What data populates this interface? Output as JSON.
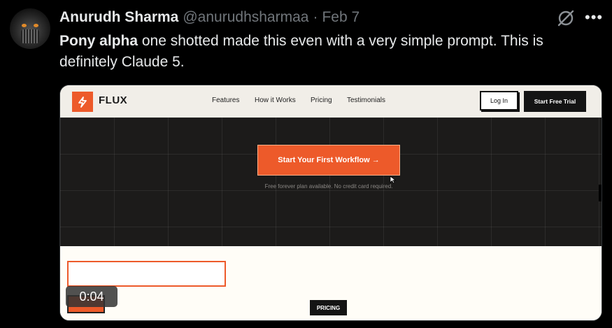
{
  "tweet": {
    "author_name": "Anurudh Sharma",
    "author_handle": "@anurudhsharmaa",
    "separator": "·",
    "date": "Feb 7",
    "text_bold": "Pony alpha",
    "text_rest": " one shotted made this even with a very simple prompt. This is definitely Claude 5."
  },
  "video": {
    "timestamp": "0:04",
    "page": {
      "brand": "FLUX",
      "nav_links": [
        "Features",
        "How it Works",
        "Pricing",
        "Testimonials"
      ],
      "login_label": "Log In",
      "trial_label": "Start Free Trial",
      "cta_label": "Start Your First Workflow →",
      "cta_note": "Free forever plan available. No credit card required.",
      "pricing_label": "PRICING"
    }
  },
  "colors": {
    "accent": "#ed5a2a",
    "background": "#000000",
    "text": "#e7e9ea",
    "muted": "#71767b"
  },
  "icons": [
    "grok-icon",
    "more-icon",
    "lightning-icon",
    "cursor-icon"
  ]
}
